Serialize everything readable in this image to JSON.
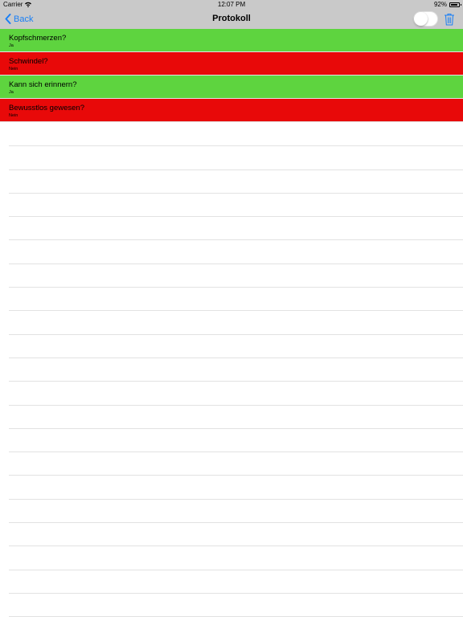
{
  "status_bar": {
    "carrier": "Carrier",
    "time": "12:07 PM",
    "battery": "92%",
    "battery_level": 0.92
  },
  "nav": {
    "back_label": "Back",
    "title": "Protokoll",
    "toggle_on": false,
    "accent_color": "#1a7ff5"
  },
  "colors": {
    "yes": "#5ed43f",
    "no": "#e80909"
  },
  "rows": [
    {
      "question": "Kopfschmerzen?",
      "answer": "Ja",
      "status": "yes"
    },
    {
      "question": "Schwindel?",
      "answer": "Nein",
      "status": "no"
    },
    {
      "question": "Kann sich erinnern?",
      "answer": "Ja",
      "status": "yes"
    },
    {
      "question": "Bewusstlos gewesen?",
      "answer": "Nein",
      "status": "no"
    }
  ],
  "icons": [
    "wifi-icon",
    "battery-icon",
    "chevron-left-icon",
    "trash-icon"
  ]
}
